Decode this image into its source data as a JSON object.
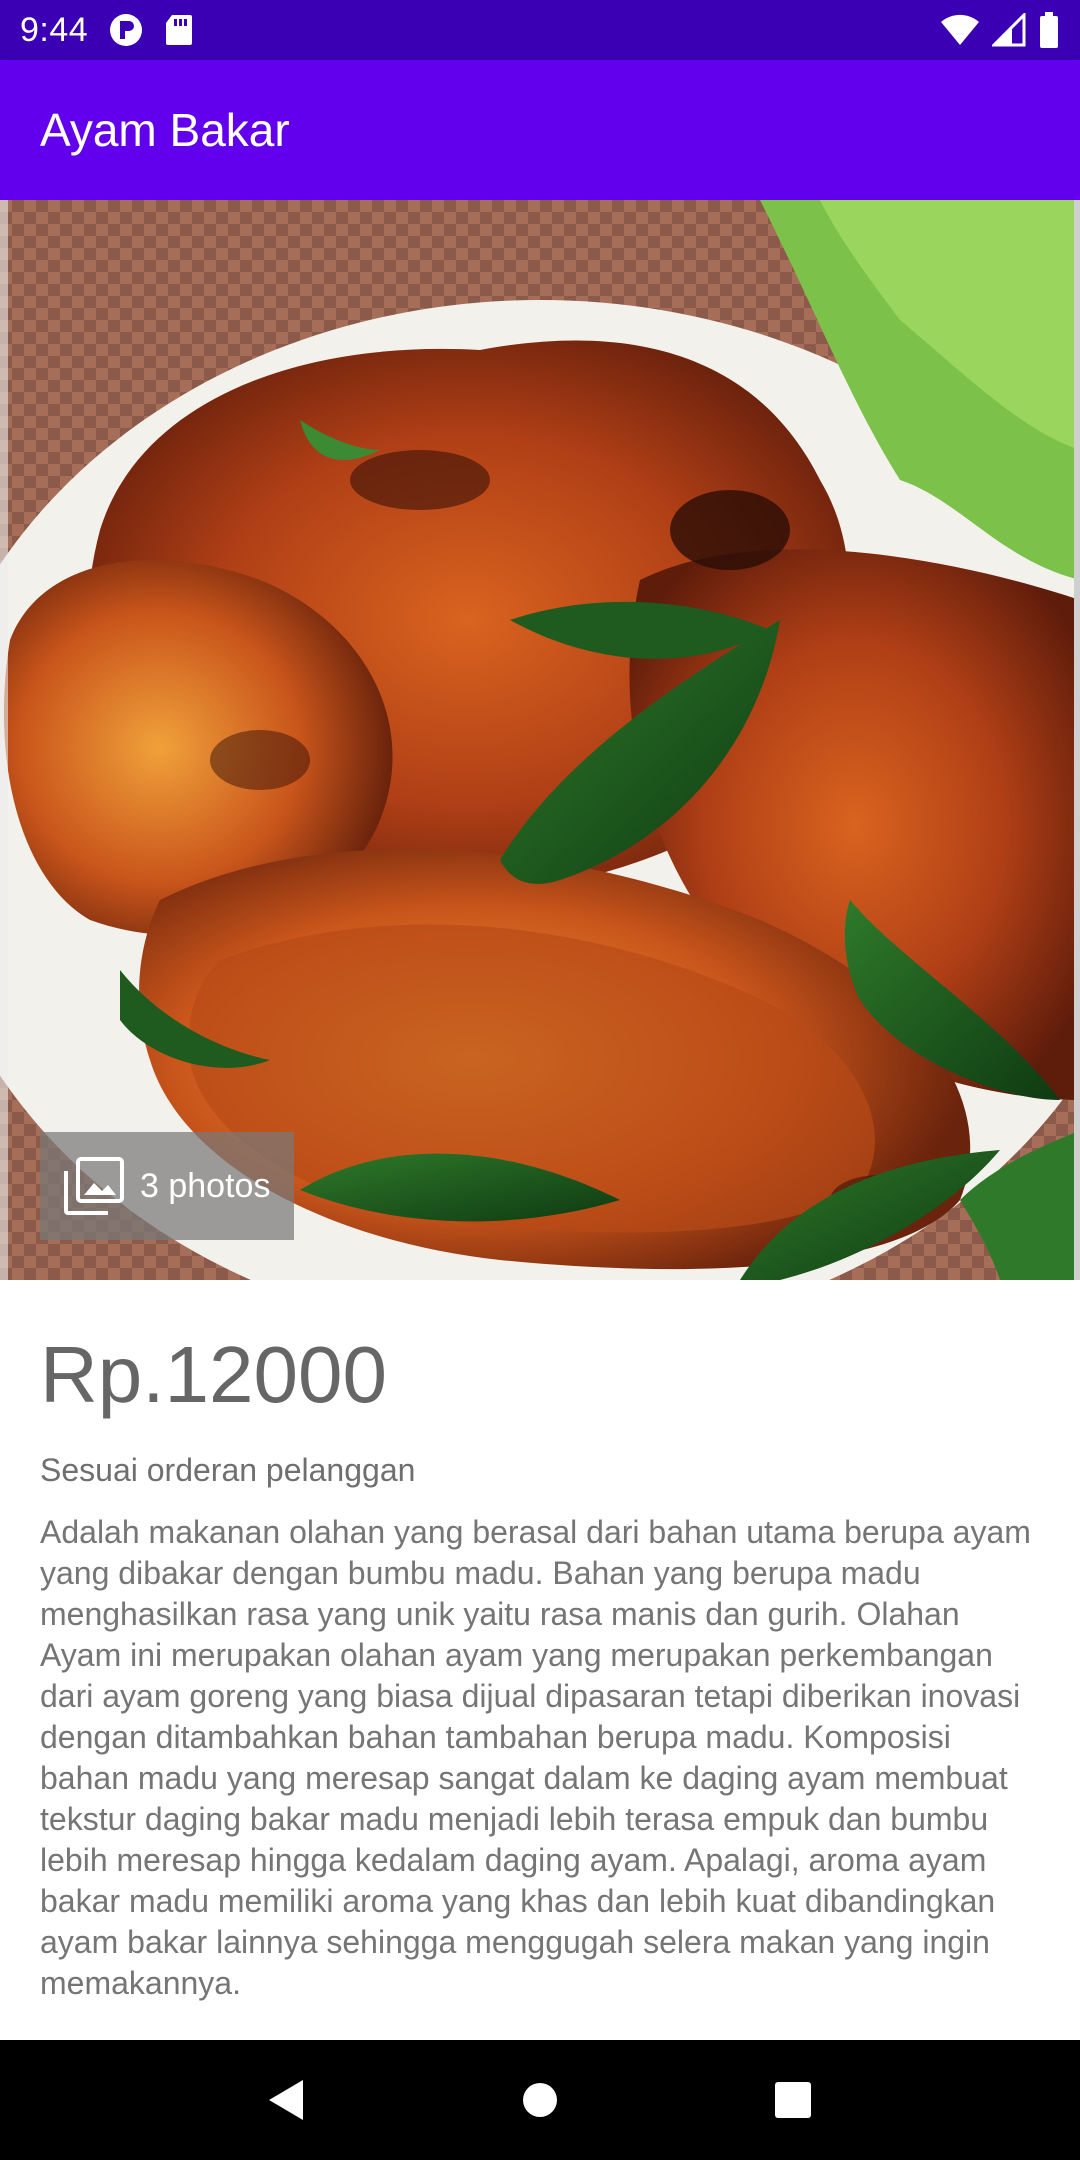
{
  "status_bar": {
    "time": "9:44",
    "left_icons": [
      "cast-icon",
      "sd-card-icon"
    ],
    "right_icons": [
      "wifi-icon",
      "cell-signal-icon",
      "battery-icon"
    ]
  },
  "app_bar": {
    "title": "Ayam Bakar",
    "color": "#6200ee",
    "status_color": "#3b00b3"
  },
  "hero": {
    "image_icon": "food-photo",
    "badge_icon": "photo-library-icon",
    "badge_label": "3 photos"
  },
  "product": {
    "price": "Rp.12000",
    "subtitle": "Sesuai orderan pelanggan",
    "description": "Adalah makanan olahan yang berasal dari bahan utama berupa ayam yang dibakar dengan bumbu madu. Bahan yang berupa madu menghasilkan rasa yang unik yaitu rasa manis dan gurih. Olahan Ayam ini merupakan olahan ayam yang merupakan perkembangan dari ayam goreng yang biasa dijual dipasaran tetapi diberikan inovasi dengan ditambahkan bahan tambahan berupa madu. Komposisi bahan madu yang meresap sangat dalam ke daging ayam membuat tekstur daging bakar madu menjadi lebih terasa empuk dan bumbu lebih meresap hingga kedalam daging ayam. Apalagi, aroma ayam bakar madu memiliki aroma yang khas dan lebih kuat dibandingkan ayam bakar lainnya sehingga menggugah selera makan yang ingin memakannya."
  },
  "nav_bar": {
    "buttons": [
      "back-icon",
      "home-icon",
      "recents-icon"
    ]
  }
}
